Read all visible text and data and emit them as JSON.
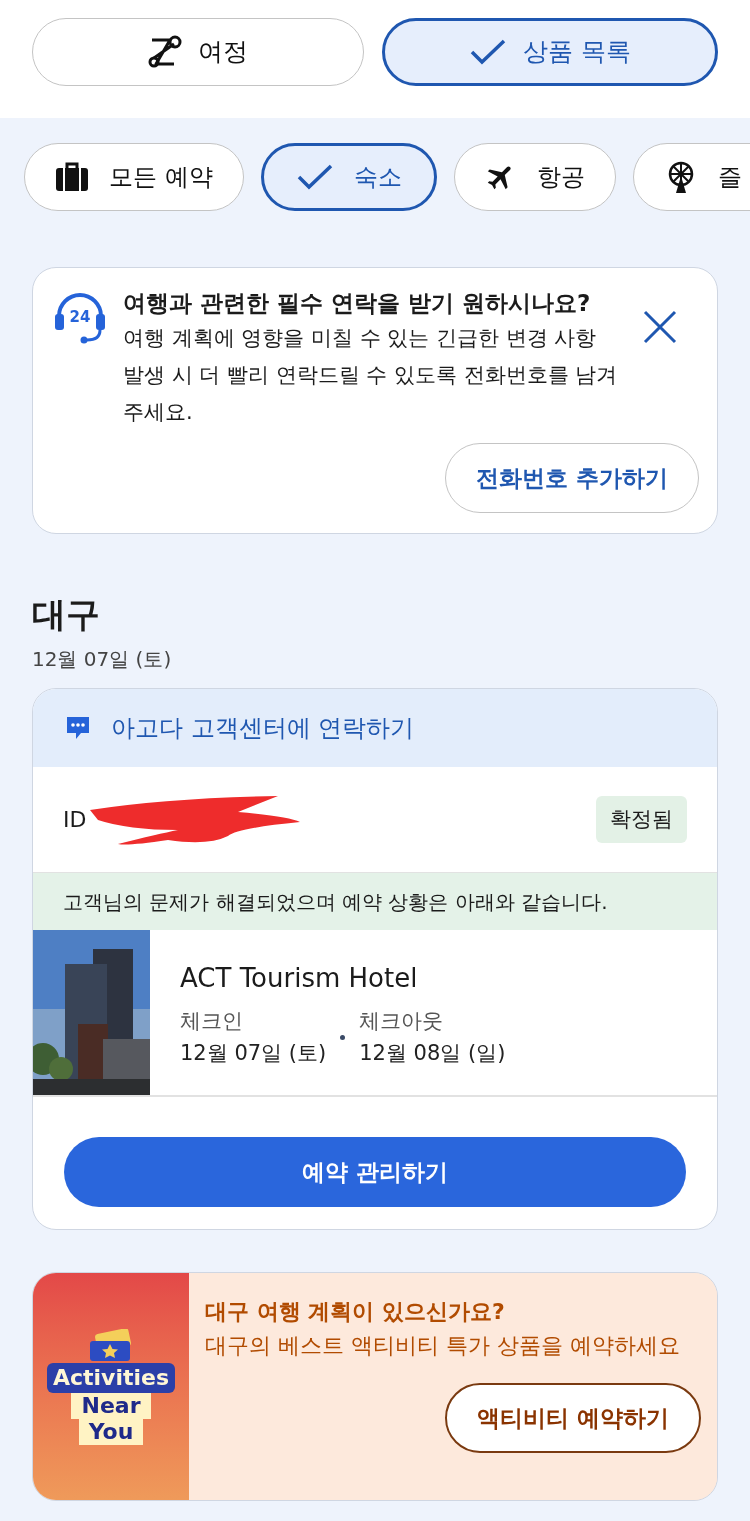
{
  "view_tabs": [
    {
      "kind": "route",
      "label": "여정",
      "selected": false
    },
    {
      "kind": "list",
      "label": "상품 목록",
      "selected": true
    }
  ],
  "filters": [
    {
      "kind": "suitcase",
      "label": "모든 예약",
      "selected": false
    },
    {
      "kind": "hotel",
      "label": "숙소",
      "selected": true
    },
    {
      "kind": "plane",
      "label": "항공",
      "selected": false
    },
    {
      "kind": "ferris",
      "label": "즐",
      "selected": false
    }
  ],
  "phone_notice": {
    "icon_badge": "24",
    "title": "여행과 관련한 필수 연락을 받기 원하시나요?",
    "body": "여행 계획에 영향을 미칠 수 있는 긴급한 변경 사항 발생 시 더 빨리 연락드릴 수 있도록 전화번호를 남겨주세요.",
    "button": "전화번호 추가하기"
  },
  "city": "대구",
  "date": "12월 07일 (토)",
  "booking": {
    "support_link": "아고다 고객센터에 연락하기",
    "id_label": "ID",
    "redacted": true,
    "status": "확정됨",
    "message": "고객님의 문제가 해결되었으며 예약 상황은 아래와 같습니다.",
    "hotel": "ACT Tourism Hotel",
    "checkin_label": "체크인",
    "checkin": "12월 07일 (토)",
    "checkout_label": "체크아웃",
    "checkout": "12월 08일 (일)",
    "manage_button": "예약 관리하기"
  },
  "promo": {
    "art_lines": [
      "Activities",
      "Near",
      "You"
    ],
    "title": "대구 여행 계획이 있으신가요?",
    "body": "대구의 베스트 액티비티 특가 상품을 예약하세요",
    "button": "액티비티 예약하기"
  }
}
